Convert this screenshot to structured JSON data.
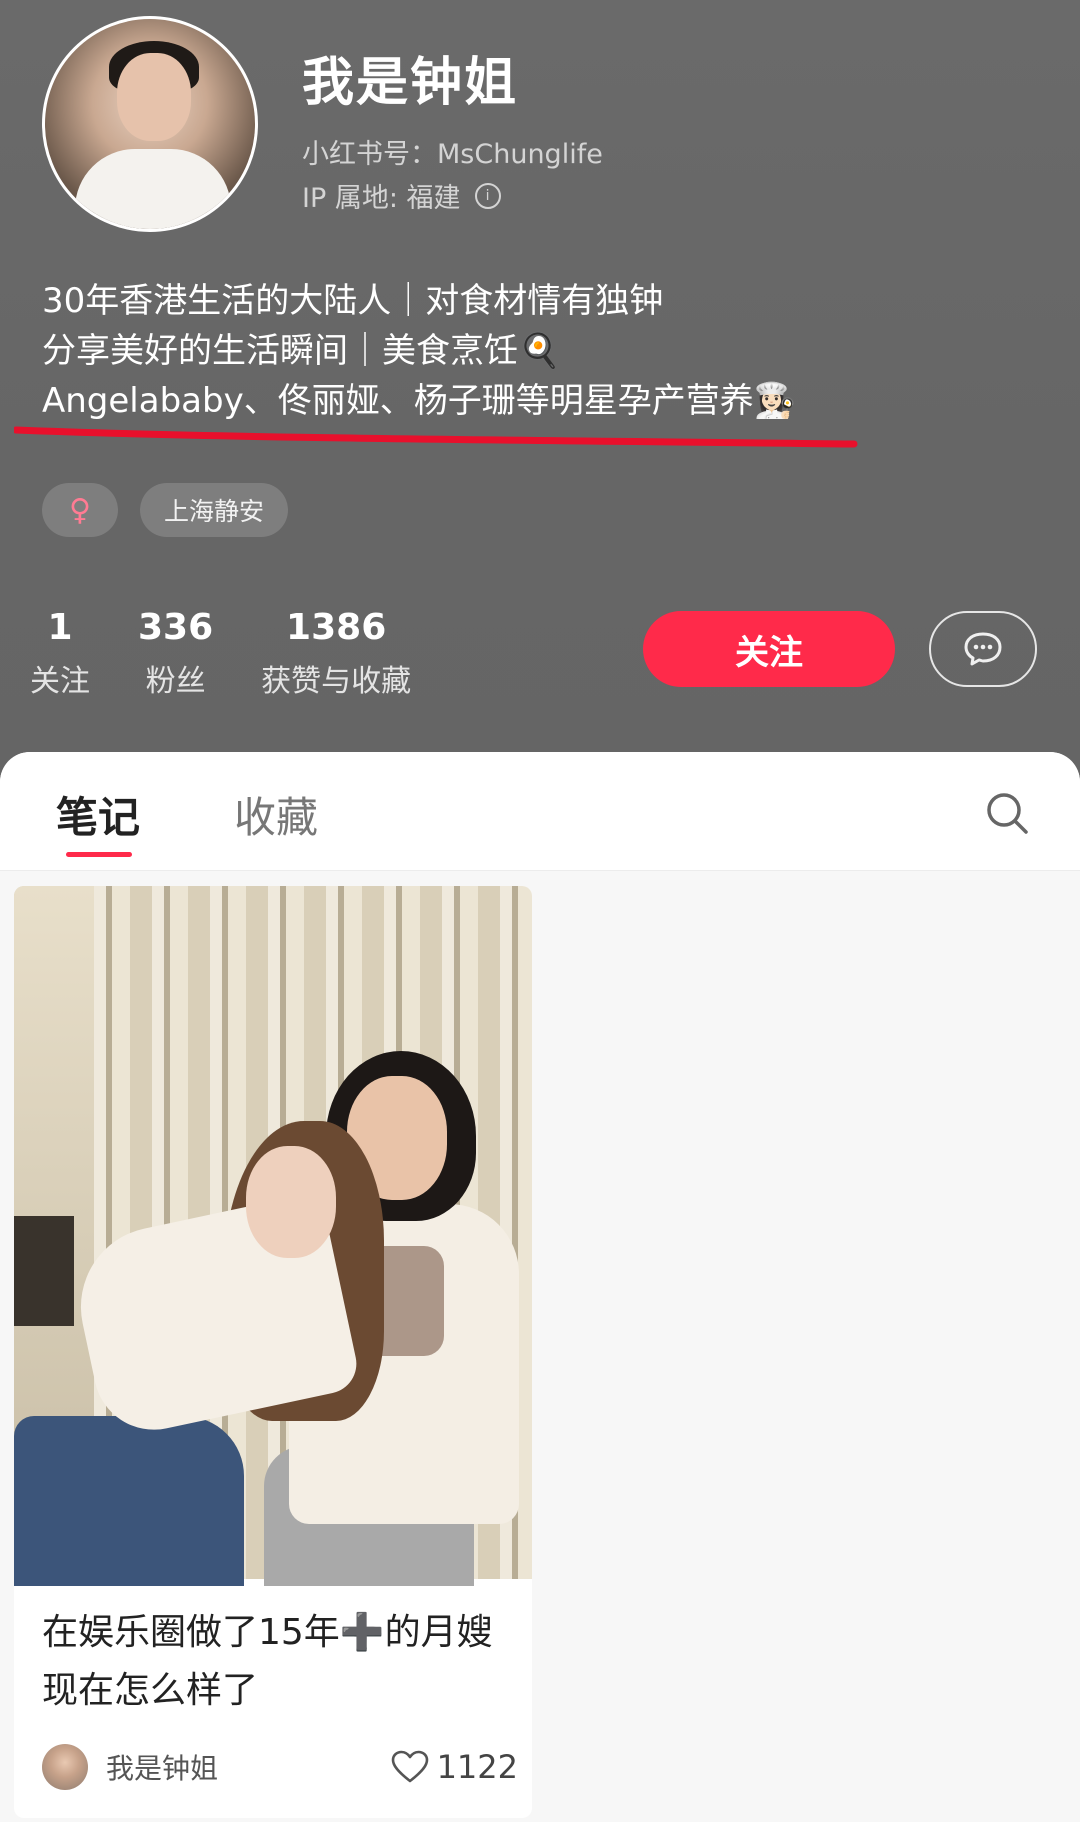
{
  "profile": {
    "name": "我是钟姐",
    "red_id": "小红书号：MsChunglife",
    "ip_location": "IP 属地: 福建",
    "bio": [
      "30年香港生活的大陆人｜对食材情有独钟",
      "分享美好的生活瞬间｜美食烹饪🍳",
      "Angelababy、佟丽娅、杨子珊等明星孕产营养👩🏻‍🍳"
    ],
    "tags": {
      "gender": "♀",
      "location": "上海静安"
    },
    "stats": [
      {
        "num": "1",
        "label": "关注"
      },
      {
        "num": "336",
        "label": "粉丝"
      },
      {
        "num": "1386",
        "label": "获赞与收藏"
      }
    ],
    "follow_label": "关注",
    "annotation_color": "#e8102c"
  },
  "tabs": {
    "notes": "笔记",
    "collections": "收藏"
  },
  "note": {
    "title": "在娱乐圈做了15年➕的月嫂 现在怎么样了",
    "author": "我是钟姐",
    "likes": "1122"
  },
  "colors": {
    "accent": "#ff2a4a",
    "header_bg": "#666666"
  }
}
